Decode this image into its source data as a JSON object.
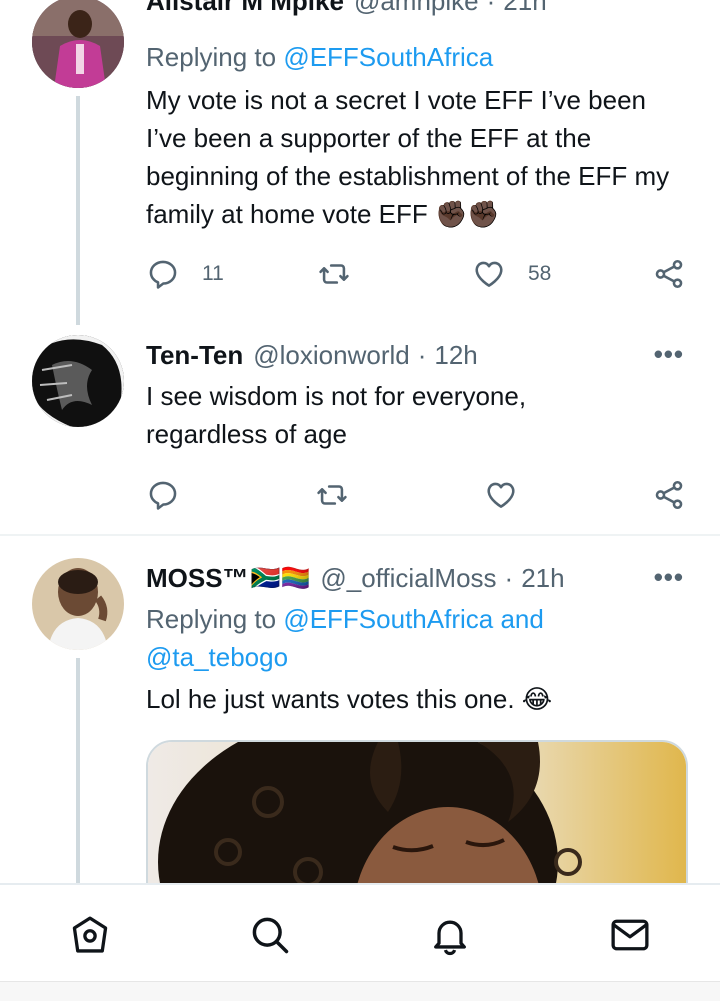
{
  "tweets": [
    {
      "name": "Alistair M Mpike",
      "handle": "@amnpike",
      "time": "21h",
      "replying_prefix": "Replying to",
      "replying_to": "@EFFSouthAfrica",
      "text": "My vote is not a secret I vote EFF I’ve been I’ve been a supporter of the EFF at the beginning of the establishment of the EFF my family at home vote EFF",
      "emoji": "✊🏿✊🏿",
      "reply_count": "11",
      "like_count": "58"
    },
    {
      "name": "Ten-Ten",
      "handle": "@loxionworld",
      "time": "12h",
      "text": "I see wisdom is not for everyone, regardless of age",
      "reply_count": "",
      "like_count": ""
    },
    {
      "name": "MOSS™",
      "flags": "🇿🇦🏳️‍🌈",
      "handle": "@_officialMoss",
      "time": "21h",
      "replying_prefix": "Replying to",
      "replying_to": "@EFFSouthAfrica and",
      "replying_to_2": "@ta_tebogo",
      "text": "Lol he just wants votes this one.",
      "emoji": "😂"
    }
  ],
  "separator_dot": "·",
  "more_glyph": "•••",
  "icons": {
    "reply": "reply-icon",
    "retweet": "retweet-icon",
    "like": "heart-icon",
    "share": "share-icon"
  },
  "bottom_nav": [
    "home-icon",
    "search-icon",
    "notifications-icon",
    "messages-icon"
  ],
  "colors": {
    "link": "#1d9bf0",
    "secondary_text": "#536471",
    "thread_line": "#cfd9de"
  }
}
